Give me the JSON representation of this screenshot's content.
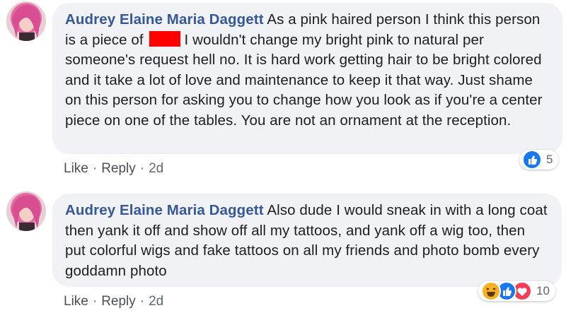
{
  "comments": [
    {
      "author": "Audrey Elaine Maria Daggett",
      "text_before": "As a pink haired person I think this person is a piece of",
      "text_after": "I wouldn't change my bright pink to natural per someone's request hell no. It is hard work getting hair to be bright colored and it take a lot of love and maintenance to keep it that way. Just shame on this person for asking you to change how you look as if you're a center piece on one of the tables. You are not an ornament at the reception.",
      "actions": {
        "like": "Like",
        "reply": "Reply",
        "age": "2d",
        "separator": "·"
      },
      "reactions": {
        "icons": [
          "like-icon"
        ],
        "count": "5"
      }
    },
    {
      "author": "Audrey Elaine Maria Daggett",
      "text": "Also dude I would sneak in with a long coat then yank it off and show off all my tattoos, and yank off a wig too, then put colorful wigs and fake tattoos on all my friends and photo bomb every goddamn photo",
      "actions": {
        "like": "Like",
        "reply": "Reply",
        "age": "2d",
        "separator": "·"
      },
      "reactions": {
        "icons": [
          "haha-icon",
          "like-icon",
          "love-icon"
        ],
        "count": "10"
      }
    }
  ],
  "colors": {
    "author": "#365899",
    "bubble": "#f0f2f5",
    "like": "#1877f2",
    "love": "#f33e58",
    "haha": "#f7b125",
    "redaction": "#ff0000"
  }
}
